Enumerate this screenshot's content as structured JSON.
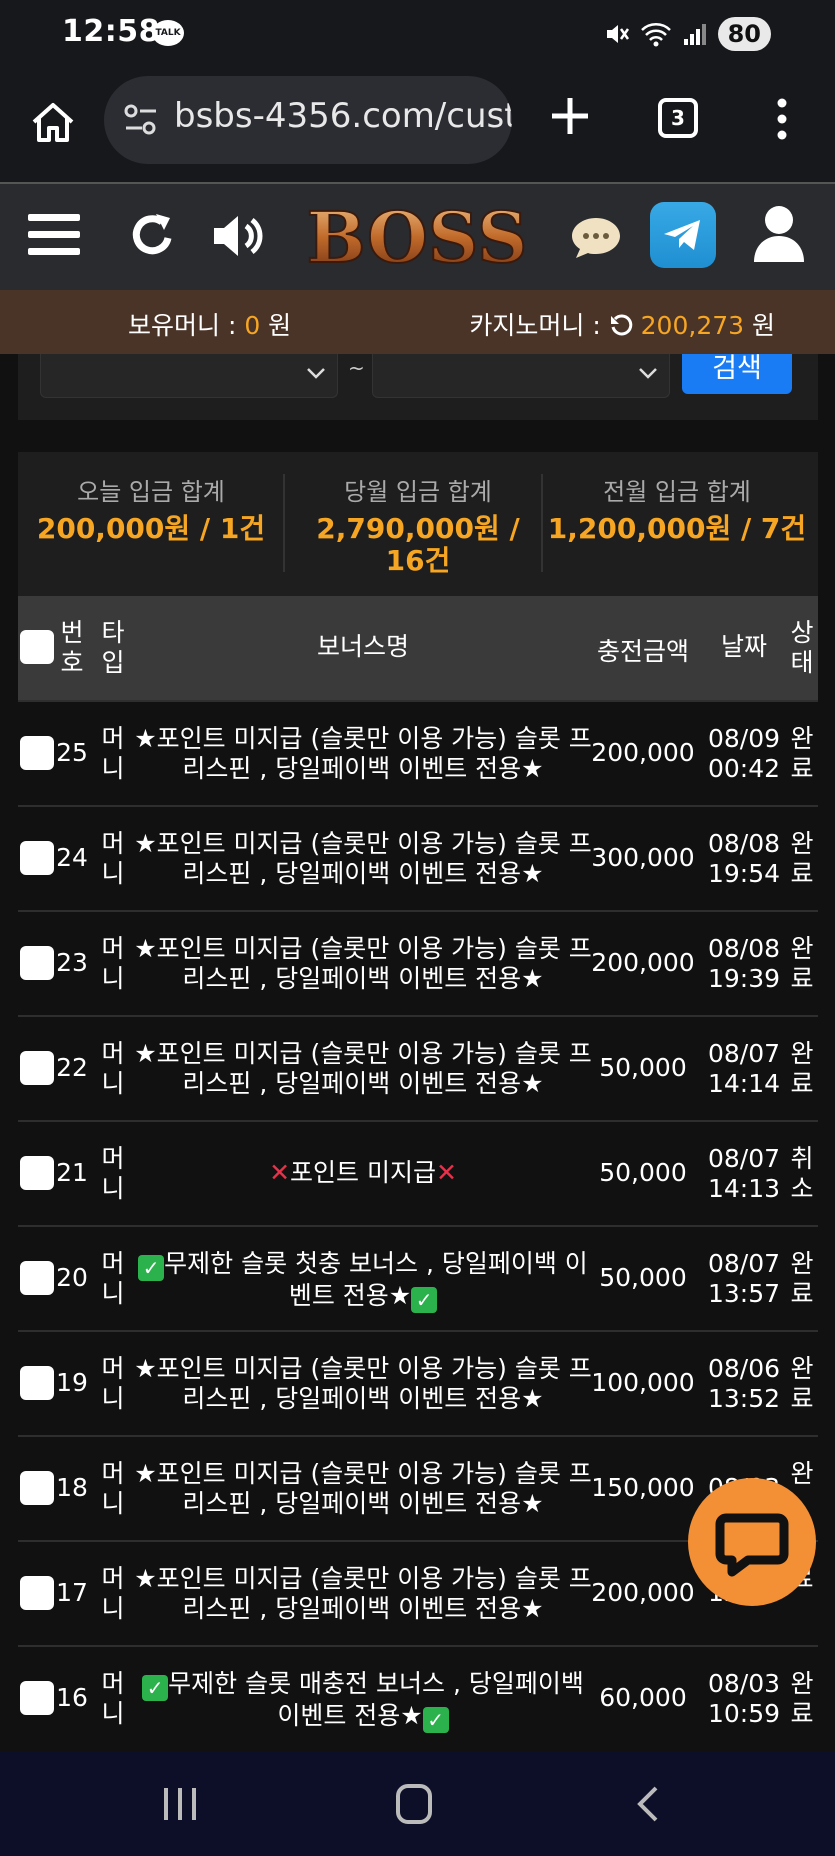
{
  "status": {
    "time": "12:58",
    "talk_badge": "TALK",
    "battery": "80"
  },
  "browser": {
    "url": "bsbs-4356.com/cust",
    "tab_count": "3"
  },
  "site": {
    "logo_text": "BOSS"
  },
  "money": {
    "holding_label": "보유머니 : ",
    "holding_value": "0",
    "holding_unit": " 원",
    "casino_label": "카지노머니 : ",
    "casino_value": "200,273",
    "casino_unit": " 원"
  },
  "search": {
    "tilde": "~",
    "button": "검색"
  },
  "summary": [
    {
      "label": "오늘 입금 합계",
      "value": "200,000원 / 1건"
    },
    {
      "label": "당월 입금 합계",
      "value": "2,790,000원 / 16건"
    },
    {
      "label": "전월 입금 합계",
      "value": "1,200,000원 / 7건"
    }
  ],
  "table": {
    "headers": {
      "num": "번호",
      "type": "타입",
      "name": "보너스명",
      "amount": "충전금액",
      "date": "날짜",
      "state": "상태"
    },
    "rows": [
      {
        "num": "25",
        "type": "머니",
        "name": "★포인트 미지급 (슬롯만 이용 가능) 슬롯 프리스핀 , 당일페이백 이벤트 전용★",
        "amount": "200,000",
        "date": "08/09 00:42",
        "state": "완료"
      },
      {
        "num": "24",
        "type": "머니",
        "name": "★포인트 미지급 (슬롯만 이용 가능) 슬롯 프리스핀 , 당일페이백 이벤트 전용★",
        "amount": "300,000",
        "date": "08/08 19:54",
        "state": "완료"
      },
      {
        "num": "23",
        "type": "머니",
        "name": "★포인트 미지급 (슬롯만 이용 가능) 슬롯 프리스핀 , 당일페이백 이벤트 전용★",
        "amount": "200,000",
        "date": "08/08 19:39",
        "state": "완료"
      },
      {
        "num": "22",
        "type": "머니",
        "name": "★포인트 미지급 (슬롯만 이용 가능) 슬롯 프리스핀 , 당일페이백 이벤트 전용★",
        "amount": "50,000",
        "date": "08/07 14:14",
        "state": "완료"
      },
      {
        "num": "21",
        "type": "머니",
        "name": "❌포인트 미지급❌",
        "amount": "50,000",
        "date": "08/07 14:13",
        "state": "취소"
      },
      {
        "num": "20",
        "type": "머니",
        "name": "✅무제한 슬롯 첫충 보너스 , 당일페이백 이벤트 전용★✅",
        "amount": "50,000",
        "date": "08/07 13:57",
        "state": "완료"
      },
      {
        "num": "19",
        "type": "머니",
        "name": "★포인트 미지급 (슬롯만 이용 가능) 슬롯 프리스핀 , 당일페이백 이벤트 전용★",
        "amount": "100,000",
        "date": "08/06 13:52",
        "state": "완료"
      },
      {
        "num": "18",
        "type": "머니",
        "name": "★포인트 미지급 (슬롯만 이용 가능) 슬롯 프리스핀 , 당일페이백 이벤트 전용★",
        "amount": "150,000",
        "date": "08/03",
        "state": "완"
      },
      {
        "num": "17",
        "type": "머니",
        "name": "★포인트 미지급 (슬롯만 이용 가능) 슬롯 프리스핀 , 당일페이백 이벤트 전용★",
        "amount": "200,000",
        "date": "12:09",
        "state": "료"
      },
      {
        "num": "16",
        "type": "머니",
        "name": "✅무제한 슬롯 매충전 보너스 , 당일페이백 이벤트 전용★✅",
        "amount": "60,000",
        "date": "08/03 10:59",
        "state": "완료"
      }
    ]
  }
}
